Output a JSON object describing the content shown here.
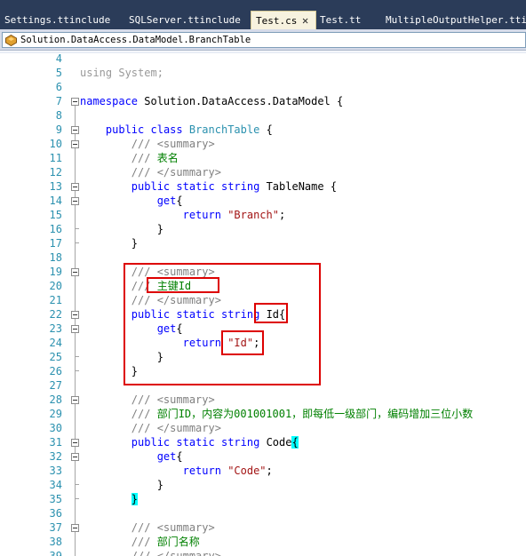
{
  "tabs": [
    {
      "label": "Settings.ttinclude",
      "active": false
    },
    {
      "label": "SQLServer.ttinclude",
      "active": false
    },
    {
      "label": "Test.cs",
      "active": true,
      "close": "✕"
    },
    {
      "label": "Test.tt",
      "active": false
    },
    {
      "label": "MultipleOutputHelper.ttinclude",
      "active": false
    }
  ],
  "nav": {
    "type_name": "Solution.DataAccess.DataModel.BranchTable"
  },
  "code_lines": [
    {
      "n": "4",
      "fold": "none",
      "parts": []
    },
    {
      "n": "5",
      "fold": "none",
      "parts": [
        {
          "t": "using System;",
          "c": "dim"
        }
      ]
    },
    {
      "n": "6",
      "fold": "none",
      "parts": []
    },
    {
      "n": "7",
      "fold": "open",
      "parts": [
        {
          "t": "namespace",
          "c": "kw"
        },
        {
          "t": " Solution.DataAccess.DataModel {",
          "c": ""
        }
      ]
    },
    {
      "n": "8",
      "fold": "none",
      "parts": []
    },
    {
      "n": "9",
      "fold": "open",
      "parts": [
        {
          "t": "    ",
          "c": ""
        },
        {
          "t": "public",
          "c": "kw"
        },
        {
          "t": " ",
          "c": ""
        },
        {
          "t": "class",
          "c": "kw"
        },
        {
          "t": " ",
          "c": ""
        },
        {
          "t": "BranchTable",
          "c": "ty"
        },
        {
          "t": " {",
          "c": ""
        }
      ]
    },
    {
      "n": "10",
      "fold": "open",
      "parts": [
        {
          "t": "        ",
          "c": ""
        },
        {
          "t": "/// ",
          "c": "cmg"
        },
        {
          "t": "<summary>",
          "c": "cmg"
        }
      ]
    },
    {
      "n": "11",
      "fold": "none",
      "parts": [
        {
          "t": "        ",
          "c": ""
        },
        {
          "t": "/// ",
          "c": "cmg"
        },
        {
          "t": "表名",
          "c": "cm"
        }
      ]
    },
    {
      "n": "12",
      "fold": "none",
      "parts": [
        {
          "t": "        ",
          "c": ""
        },
        {
          "t": "/// ",
          "c": "cmg"
        },
        {
          "t": "</summary>",
          "c": "cmg"
        }
      ]
    },
    {
      "n": "13",
      "fold": "open",
      "parts": [
        {
          "t": "        ",
          "c": ""
        },
        {
          "t": "public",
          "c": "kw"
        },
        {
          "t": " ",
          "c": ""
        },
        {
          "t": "static",
          "c": "kw"
        },
        {
          "t": " ",
          "c": ""
        },
        {
          "t": "string",
          "c": "kw"
        },
        {
          "t": " TableName {",
          "c": ""
        }
      ]
    },
    {
      "n": "14",
      "fold": "open",
      "parts": [
        {
          "t": "            ",
          "c": ""
        },
        {
          "t": "get",
          "c": "kw"
        },
        {
          "t": "{",
          "c": ""
        }
      ]
    },
    {
      "n": "15",
      "fold": "none",
      "parts": [
        {
          "t": "                ",
          "c": ""
        },
        {
          "t": "return",
          "c": "kw"
        },
        {
          "t": " ",
          "c": ""
        },
        {
          "t": "\"Branch\"",
          "c": "st"
        },
        {
          "t": ";",
          "c": ""
        }
      ]
    },
    {
      "n": "16",
      "fold": "end",
      "parts": [
        {
          "t": "            }",
          "c": ""
        }
      ]
    },
    {
      "n": "17",
      "fold": "end",
      "parts": [
        {
          "t": "        }",
          "c": ""
        }
      ]
    },
    {
      "n": "18",
      "fold": "none",
      "parts": []
    },
    {
      "n": "19",
      "fold": "open",
      "parts": [
        {
          "t": "        ",
          "c": ""
        },
        {
          "t": "/// ",
          "c": "cmg"
        },
        {
          "t": "<summary>",
          "c": "cmg"
        }
      ]
    },
    {
      "n": "20",
      "fold": "none",
      "parts": [
        {
          "t": "        ",
          "c": ""
        },
        {
          "t": "/// ",
          "c": "cmg"
        },
        {
          "t": "主键Id",
          "c": "cm"
        }
      ]
    },
    {
      "n": "21",
      "fold": "none",
      "parts": [
        {
          "t": "        ",
          "c": ""
        },
        {
          "t": "/// ",
          "c": "cmg"
        },
        {
          "t": "</summary>",
          "c": "cmg"
        }
      ]
    },
    {
      "n": "22",
      "fold": "open",
      "parts": [
        {
          "t": "        ",
          "c": ""
        },
        {
          "t": "public",
          "c": "kw"
        },
        {
          "t": " ",
          "c": ""
        },
        {
          "t": "static",
          "c": "kw"
        },
        {
          "t": " ",
          "c": ""
        },
        {
          "t": "string",
          "c": "kw"
        },
        {
          "t": " Id{",
          "c": ""
        }
      ]
    },
    {
      "n": "23",
      "fold": "open",
      "parts": [
        {
          "t": "            ",
          "c": ""
        },
        {
          "t": "get",
          "c": "kw"
        },
        {
          "t": "{",
          "c": ""
        }
      ]
    },
    {
      "n": "24",
      "fold": "none",
      "parts": [
        {
          "t": "                ",
          "c": ""
        },
        {
          "t": "return",
          "c": "kw"
        },
        {
          "t": " ",
          "c": ""
        },
        {
          "t": "\"Id\"",
          "c": "st"
        },
        {
          "t": ";",
          "c": ""
        }
      ]
    },
    {
      "n": "25",
      "fold": "end",
      "parts": [
        {
          "t": "            }",
          "c": ""
        }
      ]
    },
    {
      "n": "26",
      "fold": "end",
      "parts": [
        {
          "t": "        }",
          "c": ""
        }
      ]
    },
    {
      "n": "27",
      "fold": "none",
      "parts": []
    },
    {
      "n": "28",
      "fold": "open",
      "parts": [
        {
          "t": "        ",
          "c": ""
        },
        {
          "t": "/// ",
          "c": "cmg"
        },
        {
          "t": "<summary>",
          "c": "cmg"
        }
      ]
    },
    {
      "n": "29",
      "fold": "none",
      "parts": [
        {
          "t": "        ",
          "c": ""
        },
        {
          "t": "/// ",
          "c": "cmg"
        },
        {
          "t": "部门ID，内容为001001001，即每低一级部门，编码增加三位小数",
          "c": "cm"
        }
      ]
    },
    {
      "n": "30",
      "fold": "none",
      "parts": [
        {
          "t": "        ",
          "c": ""
        },
        {
          "t": "/// ",
          "c": "cmg"
        },
        {
          "t": "</summary>",
          "c": "cmg"
        }
      ]
    },
    {
      "n": "31",
      "fold": "open",
      "parts": [
        {
          "t": "        ",
          "c": ""
        },
        {
          "t": "public",
          "c": "kw"
        },
        {
          "t": " ",
          "c": ""
        },
        {
          "t": "static",
          "c": "kw"
        },
        {
          "t": " ",
          "c": ""
        },
        {
          "t": "string",
          "c": "kw"
        },
        {
          "t": " Code",
          "c": ""
        },
        {
          "t": "{",
          "c": "hl"
        }
      ]
    },
    {
      "n": "32",
      "fold": "open",
      "parts": [
        {
          "t": "            ",
          "c": ""
        },
        {
          "t": "get",
          "c": "kw"
        },
        {
          "t": "{",
          "c": ""
        }
      ]
    },
    {
      "n": "33",
      "fold": "none",
      "parts": [
        {
          "t": "                ",
          "c": ""
        },
        {
          "t": "return",
          "c": "kw"
        },
        {
          "t": " ",
          "c": ""
        },
        {
          "t": "\"Code\"",
          "c": "st"
        },
        {
          "t": ";",
          "c": ""
        }
      ]
    },
    {
      "n": "34",
      "fold": "end",
      "parts": [
        {
          "t": "            }",
          "c": ""
        }
      ]
    },
    {
      "n": "35",
      "fold": "end",
      "parts": [
        {
          "t": "        ",
          "c": ""
        },
        {
          "t": "}",
          "c": "hl"
        }
      ]
    },
    {
      "n": "36",
      "fold": "none",
      "parts": []
    },
    {
      "n": "37",
      "fold": "open",
      "parts": [
        {
          "t": "        ",
          "c": ""
        },
        {
          "t": "/// ",
          "c": "cmg"
        },
        {
          "t": "<summary>",
          "c": "cmg"
        }
      ]
    },
    {
      "n": "38",
      "fold": "none",
      "parts": [
        {
          "t": "        ",
          "c": ""
        },
        {
          "t": "/// ",
          "c": "cmg"
        },
        {
          "t": "部门名称",
          "c": "cm"
        }
      ]
    },
    {
      "n": "39",
      "fold": "none",
      "parts": [
        {
          "t": "        ",
          "c": ""
        },
        {
          "t": "/// ",
          "c": "cmg"
        },
        {
          "t": "</summary>",
          "c": "cmg"
        }
      ]
    }
  ]
}
